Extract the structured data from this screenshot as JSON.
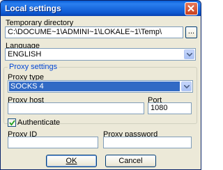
{
  "window": {
    "title": "Local settings"
  },
  "temp_dir": {
    "label": "Temporary directory",
    "value": "C:\\DOCUME~1\\ADMINI~1\\LOKALE~1\\Temp\\",
    "browse_label": "..."
  },
  "language": {
    "label": "Language",
    "selected": "ENGLISH"
  },
  "proxy": {
    "group_title": "Proxy settings",
    "type_label": "Proxy type",
    "type_selected": "SOCKS 4",
    "host_label": "Proxy host",
    "host_value": "",
    "port_label": "Port",
    "port_value": "1080"
  },
  "auth": {
    "label": "Authenticate",
    "checked": true,
    "id_label": "Proxy ID",
    "id_value": "",
    "password_label": "Proxy password",
    "password_value": ""
  },
  "buttons": {
    "ok": "OK",
    "cancel": "Cancel"
  },
  "icons": {
    "close": "close-icon",
    "dropdown": "chevron-down-icon",
    "check": "check-icon"
  }
}
